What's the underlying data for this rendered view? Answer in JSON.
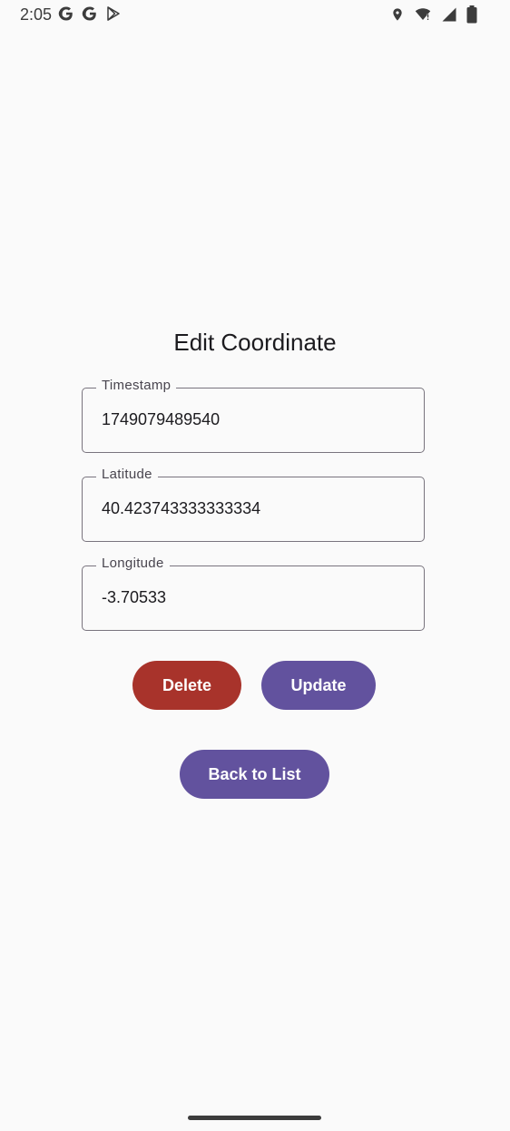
{
  "status_bar": {
    "time": "2:05",
    "left_icons": [
      "google-icon",
      "google-icon",
      "play-store-icon"
    ],
    "right_icons": [
      "location-icon",
      "wifi-icon",
      "signal-icon",
      "battery-icon"
    ]
  },
  "screen": {
    "title": "Edit Coordinate",
    "fields": [
      {
        "label": "Timestamp",
        "value": "1749079489540"
      },
      {
        "label": "Latitude",
        "value": "40.423743333333334"
      },
      {
        "label": "Longitude",
        "value": "-3.70533"
      }
    ],
    "buttons": {
      "delete": "Delete",
      "update": "Update",
      "back": "Back to List"
    }
  },
  "colors": {
    "delete": "#a8332b",
    "primary": "#62529e",
    "background": "#fafafa",
    "outline": "#79747e"
  }
}
